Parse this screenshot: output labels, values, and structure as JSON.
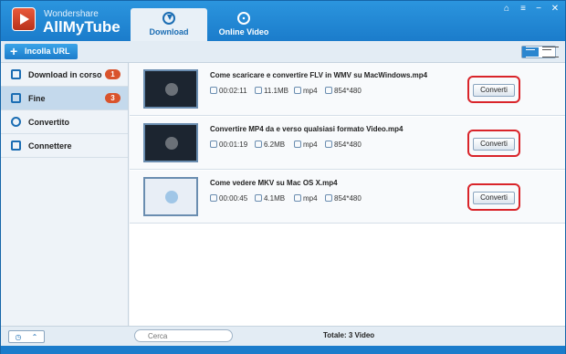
{
  "header": {
    "brand_small": "Wondershare",
    "brand_big": "AllMyTube",
    "tabs": [
      {
        "label": "Download",
        "icon": "download-icon",
        "active": true
      },
      {
        "label": "Online Video",
        "icon": "film-reel-icon",
        "active": false
      }
    ]
  },
  "toolbar": {
    "paste_label": "Incolla URL"
  },
  "sidebar": {
    "items": [
      {
        "label": "Download in corso",
        "badge": "1",
        "icon": "download-icon"
      },
      {
        "label": "Fine",
        "badge": "3",
        "icon": "finished-icon",
        "active": true
      },
      {
        "label": "Convertito",
        "icon": "convert-icon"
      },
      {
        "label": "Connettere",
        "icon": "device-icon"
      }
    ]
  },
  "videos": [
    {
      "title": "Come scaricare e convertire FLV in WMV su MacWindows.mp4",
      "duration": "00:02:11",
      "size": "11.1MB",
      "format": "mp4",
      "resolution": "854*480",
      "action": "Converti"
    },
    {
      "title": "Convertire MP4 da e verso qualsiasi formato Video.mp4",
      "duration": "00:01:19",
      "size": "6.2MB",
      "format": "mp4",
      "resolution": "854*480",
      "action": "Converti"
    },
    {
      "title": "Come vedere MKV su Mac OS X.mp4",
      "duration": "00:00:45",
      "size": "4.1MB",
      "format": "mp4",
      "resolution": "854*480",
      "action": "Converti"
    }
  ],
  "footer": {
    "search_placeholder": "Cerca",
    "total": "Totale: 3 Video"
  },
  "colors": {
    "accent": "#1b7ccb",
    "badge": "#d9532c",
    "highlight_outline": "#d9242a"
  }
}
